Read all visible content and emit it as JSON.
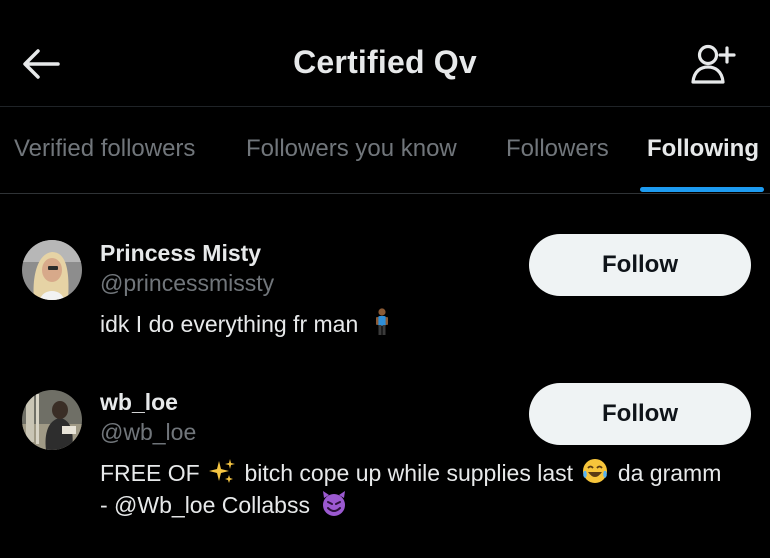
{
  "header": {
    "title": "Certified Qv",
    "back_icon": "arrow-left-icon",
    "add_icon": "person-add-icon"
  },
  "tabs": [
    {
      "label": "Verified followers",
      "active": false
    },
    {
      "label": "Followers you know",
      "active": false
    },
    {
      "label": "Followers",
      "active": false
    },
    {
      "label": "Following",
      "active": true
    }
  ],
  "accent_color": "#1d9bf0",
  "users": [
    {
      "name": "Princess Misty",
      "handle": "@princessmissty",
      "bio_line1": "idk I do everything fr man",
      "follow_label": "Follow"
    },
    {
      "name": "wb_loe",
      "handle": "@wb_loe",
      "bio_line1_a": "FREE OF",
      "bio_line1_b": "bitch cope up while supplies last",
      "bio_line1_c": "da gramm",
      "bio_line2": "- @Wb_loe Collabss",
      "follow_label": "Follow"
    }
  ]
}
